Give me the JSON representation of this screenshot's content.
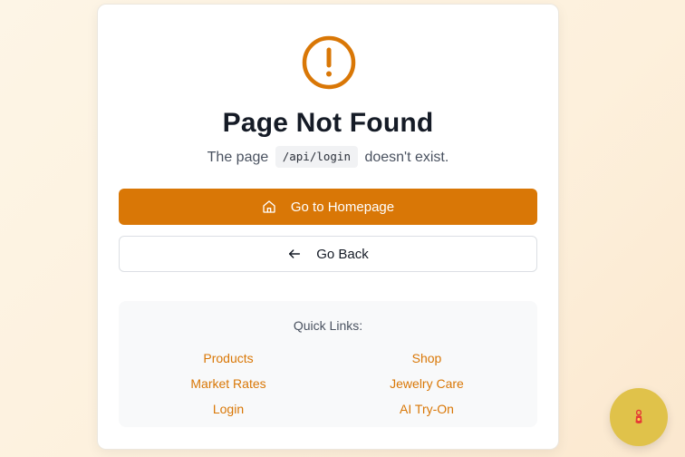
{
  "error": {
    "title": "Page Not Found",
    "subtitle_prefix": "The page",
    "path": "/api/login",
    "subtitle_suffix": "doesn't exist.",
    "icon": "alert-circle-icon"
  },
  "actions": {
    "home_label": "Go to Homepage",
    "back_label": "Go Back"
  },
  "quick_links": {
    "title": "Quick Links:",
    "items": [
      "Products",
      "Shop",
      "Market Rates",
      "Jewelry Care",
      "Login",
      "AI Try-On"
    ]
  },
  "colors": {
    "accent": "#d97706",
    "fab": "#e0c24a",
    "heading": "#151b26"
  }
}
